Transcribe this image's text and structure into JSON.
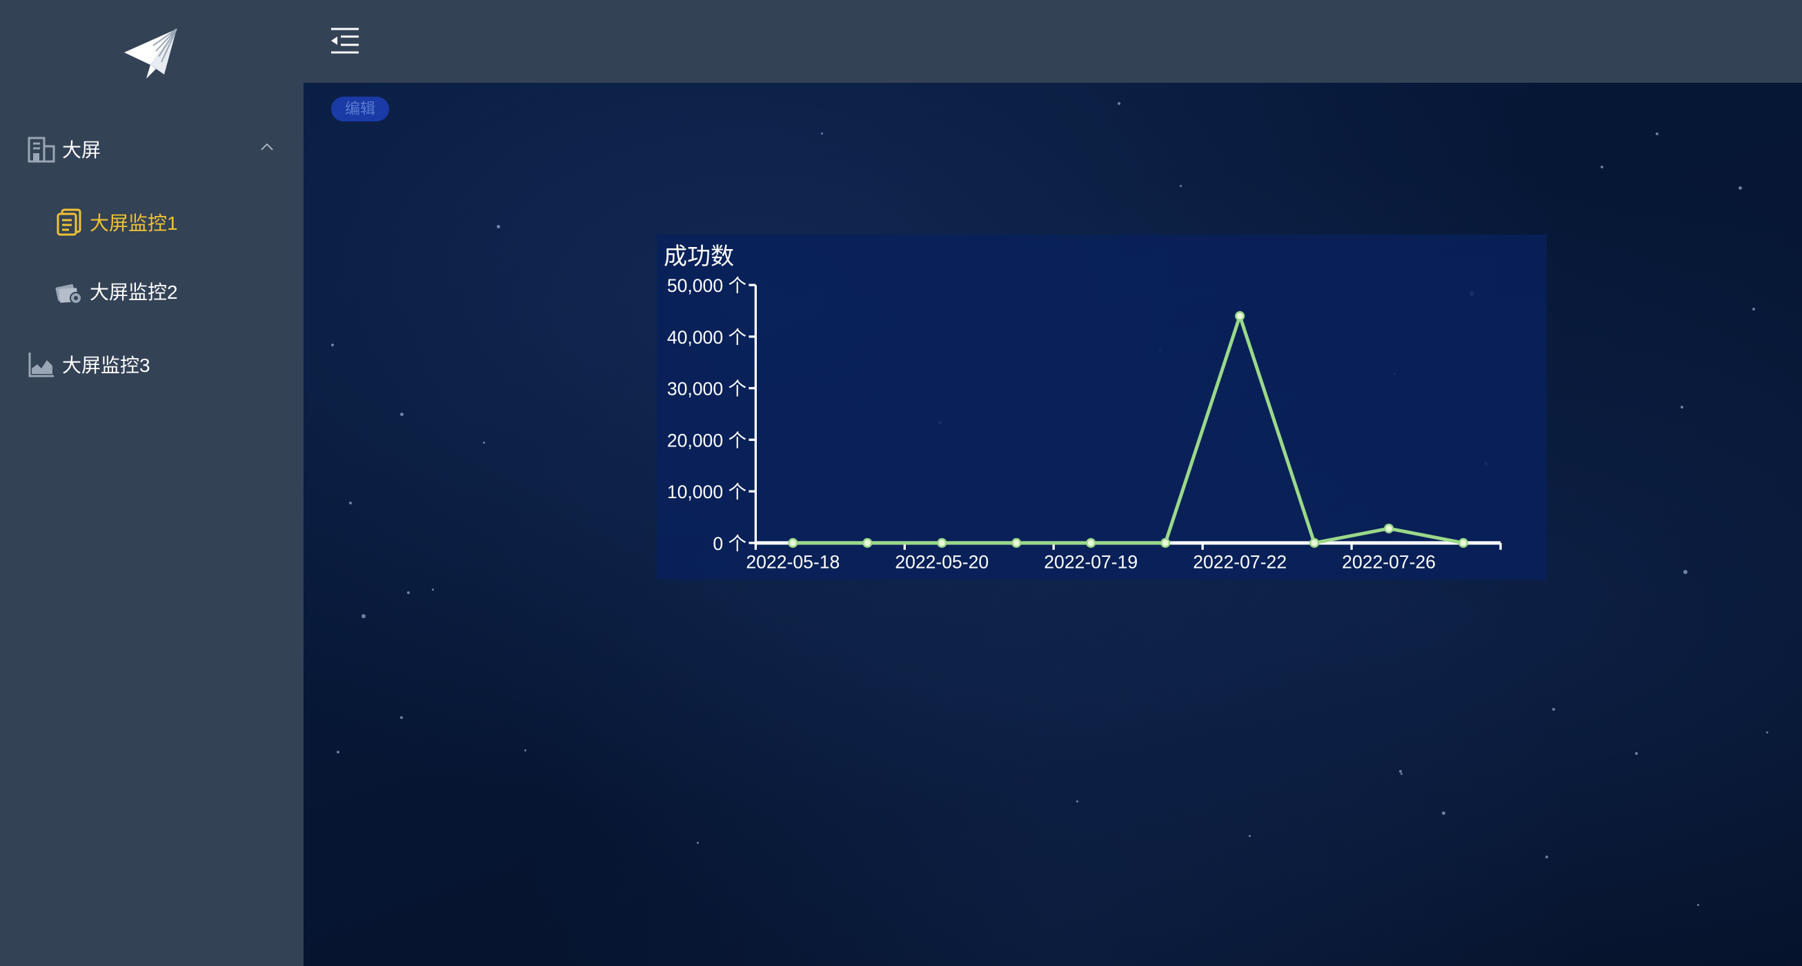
{
  "sidebar": {
    "items": [
      {
        "label": "大屏",
        "icon": "building-icon",
        "expanded": true
      },
      {
        "label": "大屏监控1",
        "icon": "document-list-icon",
        "active": true
      },
      {
        "label": "大屏监控2",
        "icon": "money-settings-icon"
      },
      {
        "label": "大屏监控3",
        "icon": "area-chart-icon"
      }
    ],
    "active_color": "#f1c232"
  },
  "header": {
    "collapse_icon": "menu-fold-icon"
  },
  "main": {
    "edit_label": "编辑"
  },
  "chart_data": {
    "type": "line",
    "title": "成功数",
    "x": [
      "2022-05-18",
      "",
      "2022-05-20",
      "",
      "2022-07-19",
      "",
      "2022-07-22",
      "",
      "2022-07-26",
      ""
    ],
    "tick_labels": [
      "2022-05-18",
      "2022-05-20",
      "2022-07-19",
      "2022-07-22",
      "2022-07-26"
    ],
    "series": [
      {
        "values": [
          0,
          0,
          0,
          0,
          0,
          0,
          44000,
          0,
          2800,
          0
        ],
        "color": "#9bd88a"
      }
    ],
    "y_ticks": [
      "50,000 个",
      "40,000 个",
      "30,000 个",
      "20,000 个",
      "10,000 个",
      "0 个"
    ],
    "ylim": [
      0,
      50000
    ],
    "grid": false
  }
}
